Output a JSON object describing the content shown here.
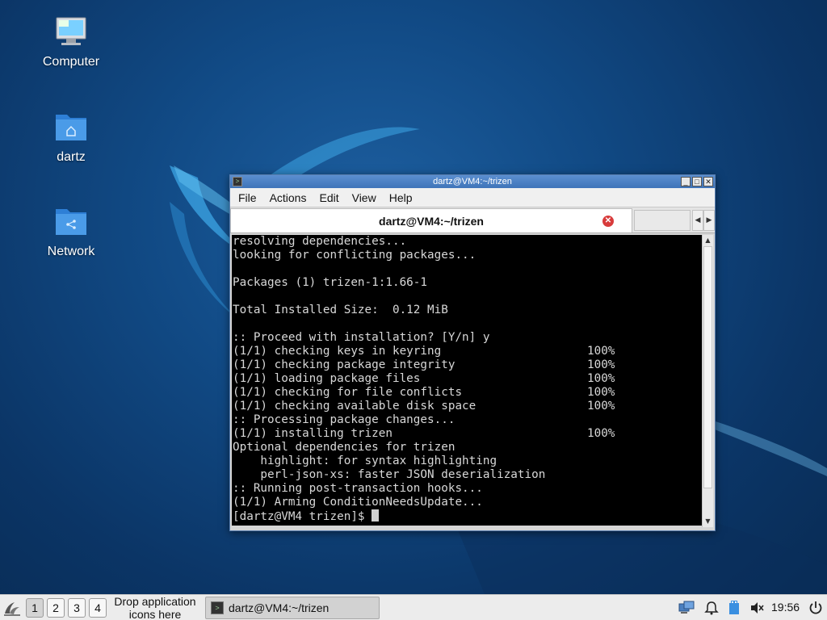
{
  "desktop": {
    "icons": [
      {
        "label": "Computer",
        "icon": "computer-icon"
      },
      {
        "label": "dartz",
        "icon": "home-folder-icon"
      },
      {
        "label": "Network",
        "icon": "network-folder-icon"
      }
    ]
  },
  "window": {
    "title": "dartz@VM4:~/trizen",
    "controls": {
      "minimize": "_",
      "maximize": "□",
      "close": "✕"
    },
    "menu": [
      "File",
      "Actions",
      "Edit",
      "View",
      "Help"
    ],
    "tab_title": "dartz@VM4:~/trizen",
    "terminal_lines": [
      "resolving dependencies...",
      "looking for conflicting packages...",
      "",
      "Packages (1) trizen-1:1.66-1",
      "",
      "Total Installed Size:  0.12 MiB",
      "",
      ":: Proceed with installation? [Y/n] y",
      "(1/1) checking keys in keyring                     100%",
      "(1/1) checking package integrity                   100%",
      "(1/1) loading package files                        100%",
      "(1/1) checking for file conflicts                  100%",
      "(1/1) checking available disk space                100%",
      ":: Processing package changes...",
      "(1/1) installing trizen                            100%",
      "Optional dependencies for trizen",
      "    highlight: for syntax highlighting",
      "    perl-json-xs: faster JSON deserialization",
      ":: Running post-transaction hooks...",
      "(1/1) Arming ConditionNeedsUpdate..."
    ],
    "prompt": "[dartz@VM4 trizen]$ "
  },
  "taskbar": {
    "workspaces": [
      "1",
      "2",
      "3",
      "4"
    ],
    "active_workspace": "1",
    "drop_hint_line1": "Drop application",
    "drop_hint_line2": "icons here",
    "task_label": "dartz@VM4:~/trizen",
    "clock": "19:56"
  },
  "colors": {
    "desktop_bg": "#114a85",
    "titlebar": "#4a80c4",
    "terminal_bg": "#000000",
    "terminal_fg": "#d8d8d8"
  }
}
